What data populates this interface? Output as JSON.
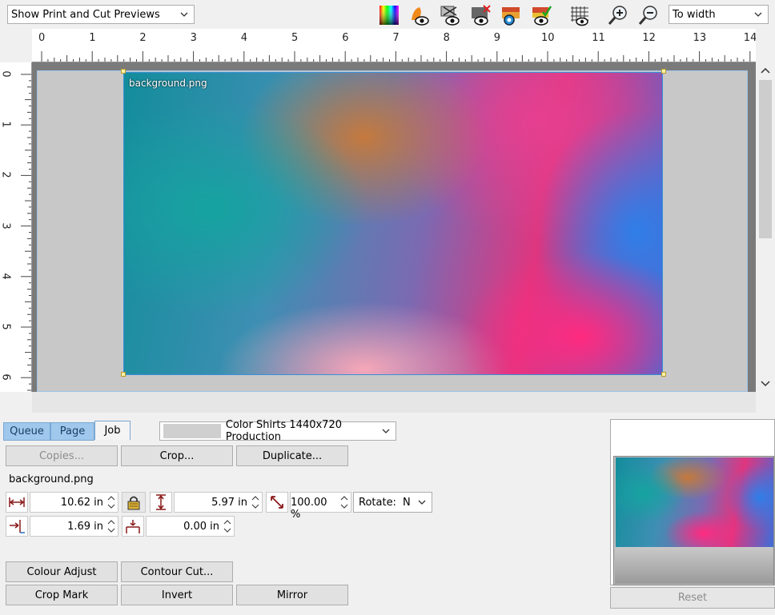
{
  "toolbar": {
    "preview_mode": "Show Print and Cut Previews",
    "zoom_mode": "To width",
    "icons": [
      "color-palette-icon",
      "print-preview-icon",
      "cut-preview-icon",
      "hide-preview-icon",
      "camera-preview-icon",
      "color-check-icon",
      "grid-icon",
      "zoom-in-icon",
      "zoom-out-icon"
    ]
  },
  "ruler_h": {
    "labels": [
      "0",
      "1",
      "2",
      "3",
      "4",
      "5",
      "6",
      "7",
      "8",
      "9",
      "10",
      "11",
      "12",
      "13",
      "14"
    ]
  },
  "ruler_v": {
    "labels": [
      "0",
      "1",
      "2",
      "3",
      "4",
      "5",
      "6"
    ]
  },
  "canvas": {
    "image_label": "background.png"
  },
  "tabs": [
    "Queue",
    "Page",
    "Job"
  ],
  "active_tab": "Job",
  "printer_profile": "Color Shirts 1440x720 Production",
  "buttons": {
    "copies": "Copies...",
    "crop": "Crop...",
    "duplicate": "Duplicate...",
    "colour_adjust": "Colour Adjust",
    "contour_cut": "Contour Cut...",
    "crop_mark": "Crop Mark",
    "invert": "Invert",
    "mirror": "Mirror",
    "reset": "Reset"
  },
  "job": {
    "filename": "background.png",
    "width": "10.62 in",
    "height": "5.97 in",
    "scale": "100.00 %",
    "rotate_label": "Rotate:",
    "rotate_value": "N",
    "x_offset": "1.69 in",
    "y_offset": "0.00 in"
  }
}
